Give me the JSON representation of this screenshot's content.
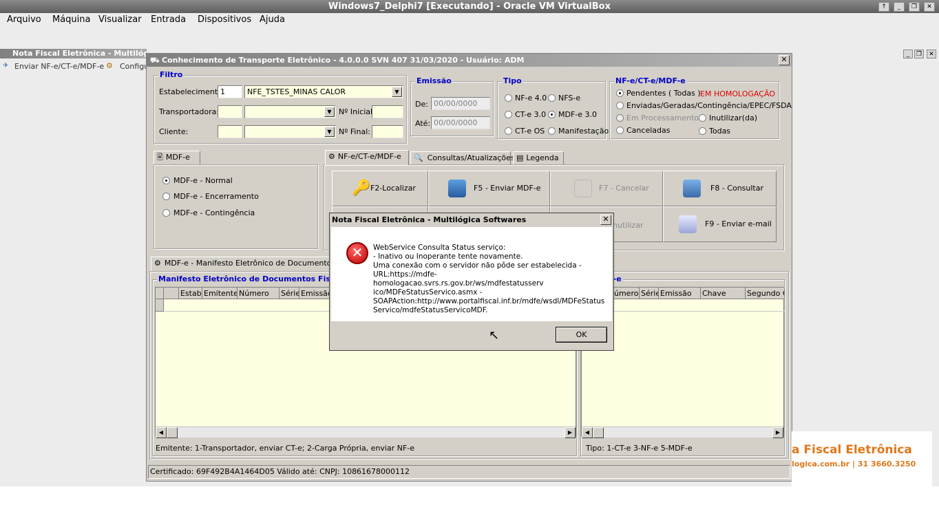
{
  "vbox": {
    "title": "Windows7_Delphi7 [Executando] - Oracle VM VirtualBox",
    "menu": [
      "Arquivo",
      "Máquina",
      "Visualizar",
      "Entrada",
      "Dispositivos",
      "Ajuda"
    ]
  },
  "mdi": {
    "title": "Nota Fiscal Eletrônica - Multilógica",
    "menu": [
      "Enviar NF-e/CT-e/MDF-e",
      "Configu"
    ]
  },
  "main": {
    "title": "Conhecimento de Transporte Eletrônico - 4.0.0.0 SVN 407 31/03/2020 - Usuário: ADM",
    "filtro": {
      "legend": "Filtro",
      "estab_label": "Estabelecimento:",
      "estab_code": "1",
      "estab_name": "NFE_TSTES_MINAS CALOR",
      "transp_label": "Transportadora:",
      "cliente_label": "Cliente:",
      "ninicial_label": "Nº Inicial:",
      "nfinal_label": "Nº Final:"
    },
    "emissao": {
      "legend": "Emissão",
      "de_label": "De:",
      "ate_label": "Até:",
      "de_value": "00/00/0000",
      "ate_value": "00/00/0000"
    },
    "tipo": {
      "legend": "Tipo",
      "options": [
        "NF-e 4.0",
        "NFS-e",
        "CT-e 3.0",
        "MDF-e 3.0",
        "CT-e OS",
        "Manifestação"
      ]
    },
    "status": {
      "legend": "NF-e/CT-e/MDF-e",
      "homolog": "EM HOMOLOGAÇÃO",
      "options": [
        "Pendentes ( Todas )",
        "Enviadas/Geradas/Contingência/EPEC/FSDA",
        "Em Processamento",
        "Inutilizar(da)",
        "Canceladas",
        "Todas"
      ]
    },
    "mdfe_tab": "MDF-e",
    "mdfe_options": [
      "MDF-e - Normal",
      "MDF-e - Encerramento",
      "MDF-e - Contingência"
    ],
    "tabs": [
      "NF-e/CT-e/MDF-e",
      "Consultas/Atualizações",
      "Legenda"
    ],
    "buttons": {
      "f2": "F2-Localizar",
      "f5": "F5 - Enviar MDF-e",
      "f7": "F7 - Cancelar",
      "f8": "F8 - Consultar",
      "inut": "nutilizar",
      "f9": "F9 - Enviar e-mail"
    },
    "lower_tab": "MDF-e - Manifesto Eletrônico de Documentos Fis",
    "grid1": {
      "legend": "Manifesto Eletrônico de Documentos Fiscais",
      "cols": [
        "Estab",
        "Emitente",
        "Número",
        "Série",
        "Emissão"
      ],
      "footer": "Emitente: 1-Transportador, enviar CT-e;  2-Carga Própria, enviar NF-e"
    },
    "grid2": {
      "legend": "e/MDF-e",
      "cols": [
        "úmero",
        "Série",
        "Emissão",
        "Chave",
        "Segundo C"
      ],
      "footer": "Tipo: 1-CT-e   3-NF-e  5-MDF-e"
    },
    "status_bar": "Certificado: 69F492B4A1464D05 Válido até:  CNPJ: 10861678000112"
  },
  "dialog": {
    "title": "Nota Fiscal Eletrônica - Multilógica Softwares",
    "message": "WebService Consulta Status serviço:\n- Inativo ou Inoperante tente novamente.\nUma conexão com o servidor não pôde ser estabelecida -\nURL:https://mdfe-homologacao.svrs.rs.gov.br/ws/mdfestatusserv\nico/MDFeStatusServico.asmx -\nSOAPAction:http://www.portalfiscal.inf.br/mdfe/wsdl/MDFeStatus\nServico/mdfeStatusServicoMDF.",
    "ok": "OK"
  },
  "banner": {
    "line1": "a  Fiscal  Eletrônica",
    "line2": "logica.com.br | 31 3660.3250"
  }
}
